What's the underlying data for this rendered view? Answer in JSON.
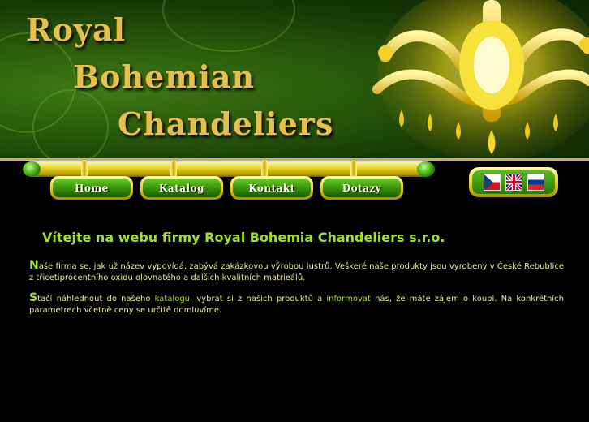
{
  "header": {
    "title_lines": [
      "Royal",
      "Bohemian",
      "Chandeliers"
    ]
  },
  "nav": [
    {
      "label": "Home"
    },
    {
      "label": "Katalog"
    },
    {
      "label": "Kontakt"
    },
    {
      "label": "Dotazy"
    }
  ],
  "languages": [
    {
      "code": "cz",
      "icon": "czech-flag-icon"
    },
    {
      "code": "en",
      "icon": "uk-flag-icon"
    },
    {
      "code": "ru",
      "icon": "russian-flag-icon"
    }
  ],
  "main": {
    "heading": "Vítejte na webu firmy Royal Bohemia Chandeliers s.r.o.",
    "p1": {
      "initial": "N",
      "text": "aše firma se, jak už název vypovídá, zabývá zakázkovou výrobou lustrů. Veškeré naše produkty jsou vyrobeny v České Rebublice z třicetiprocentního oxidu olovnatého a dalších kvalitních matrieálů."
    },
    "p2": {
      "initial": "S",
      "before_link1": "tačí náhlednout do našeho ",
      "link1": "katalogu",
      "between": ", vybrat si z našich produktů a ",
      "link2": "informovat",
      "after": " nás, že máte zájem o koupi. Na konkrétních parametrech včetně ceny se určitě domluvíme."
    }
  },
  "colors": {
    "accent_green": "#9fe02a",
    "text_yellow": "#e8e89a",
    "gold": "#e5c14c",
    "background": "#000000"
  }
}
